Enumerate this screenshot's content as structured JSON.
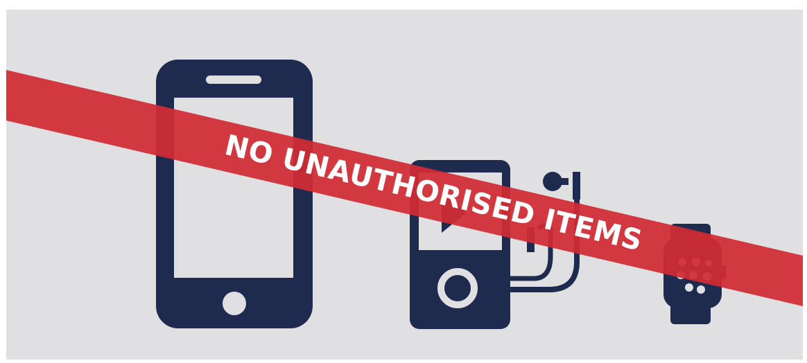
{
  "sign": {
    "banner_text": "NO UNAUTHORISED ITEMS",
    "background_color": "#e0e0e2",
    "icon_color": "#1f2a4f",
    "banner_color": "#d12b33",
    "banner_text_color": "#ffffff",
    "icons": [
      "smartphone-icon",
      "mp3-player-icon",
      "earphones-icon",
      "smartwatch-icon"
    ]
  }
}
